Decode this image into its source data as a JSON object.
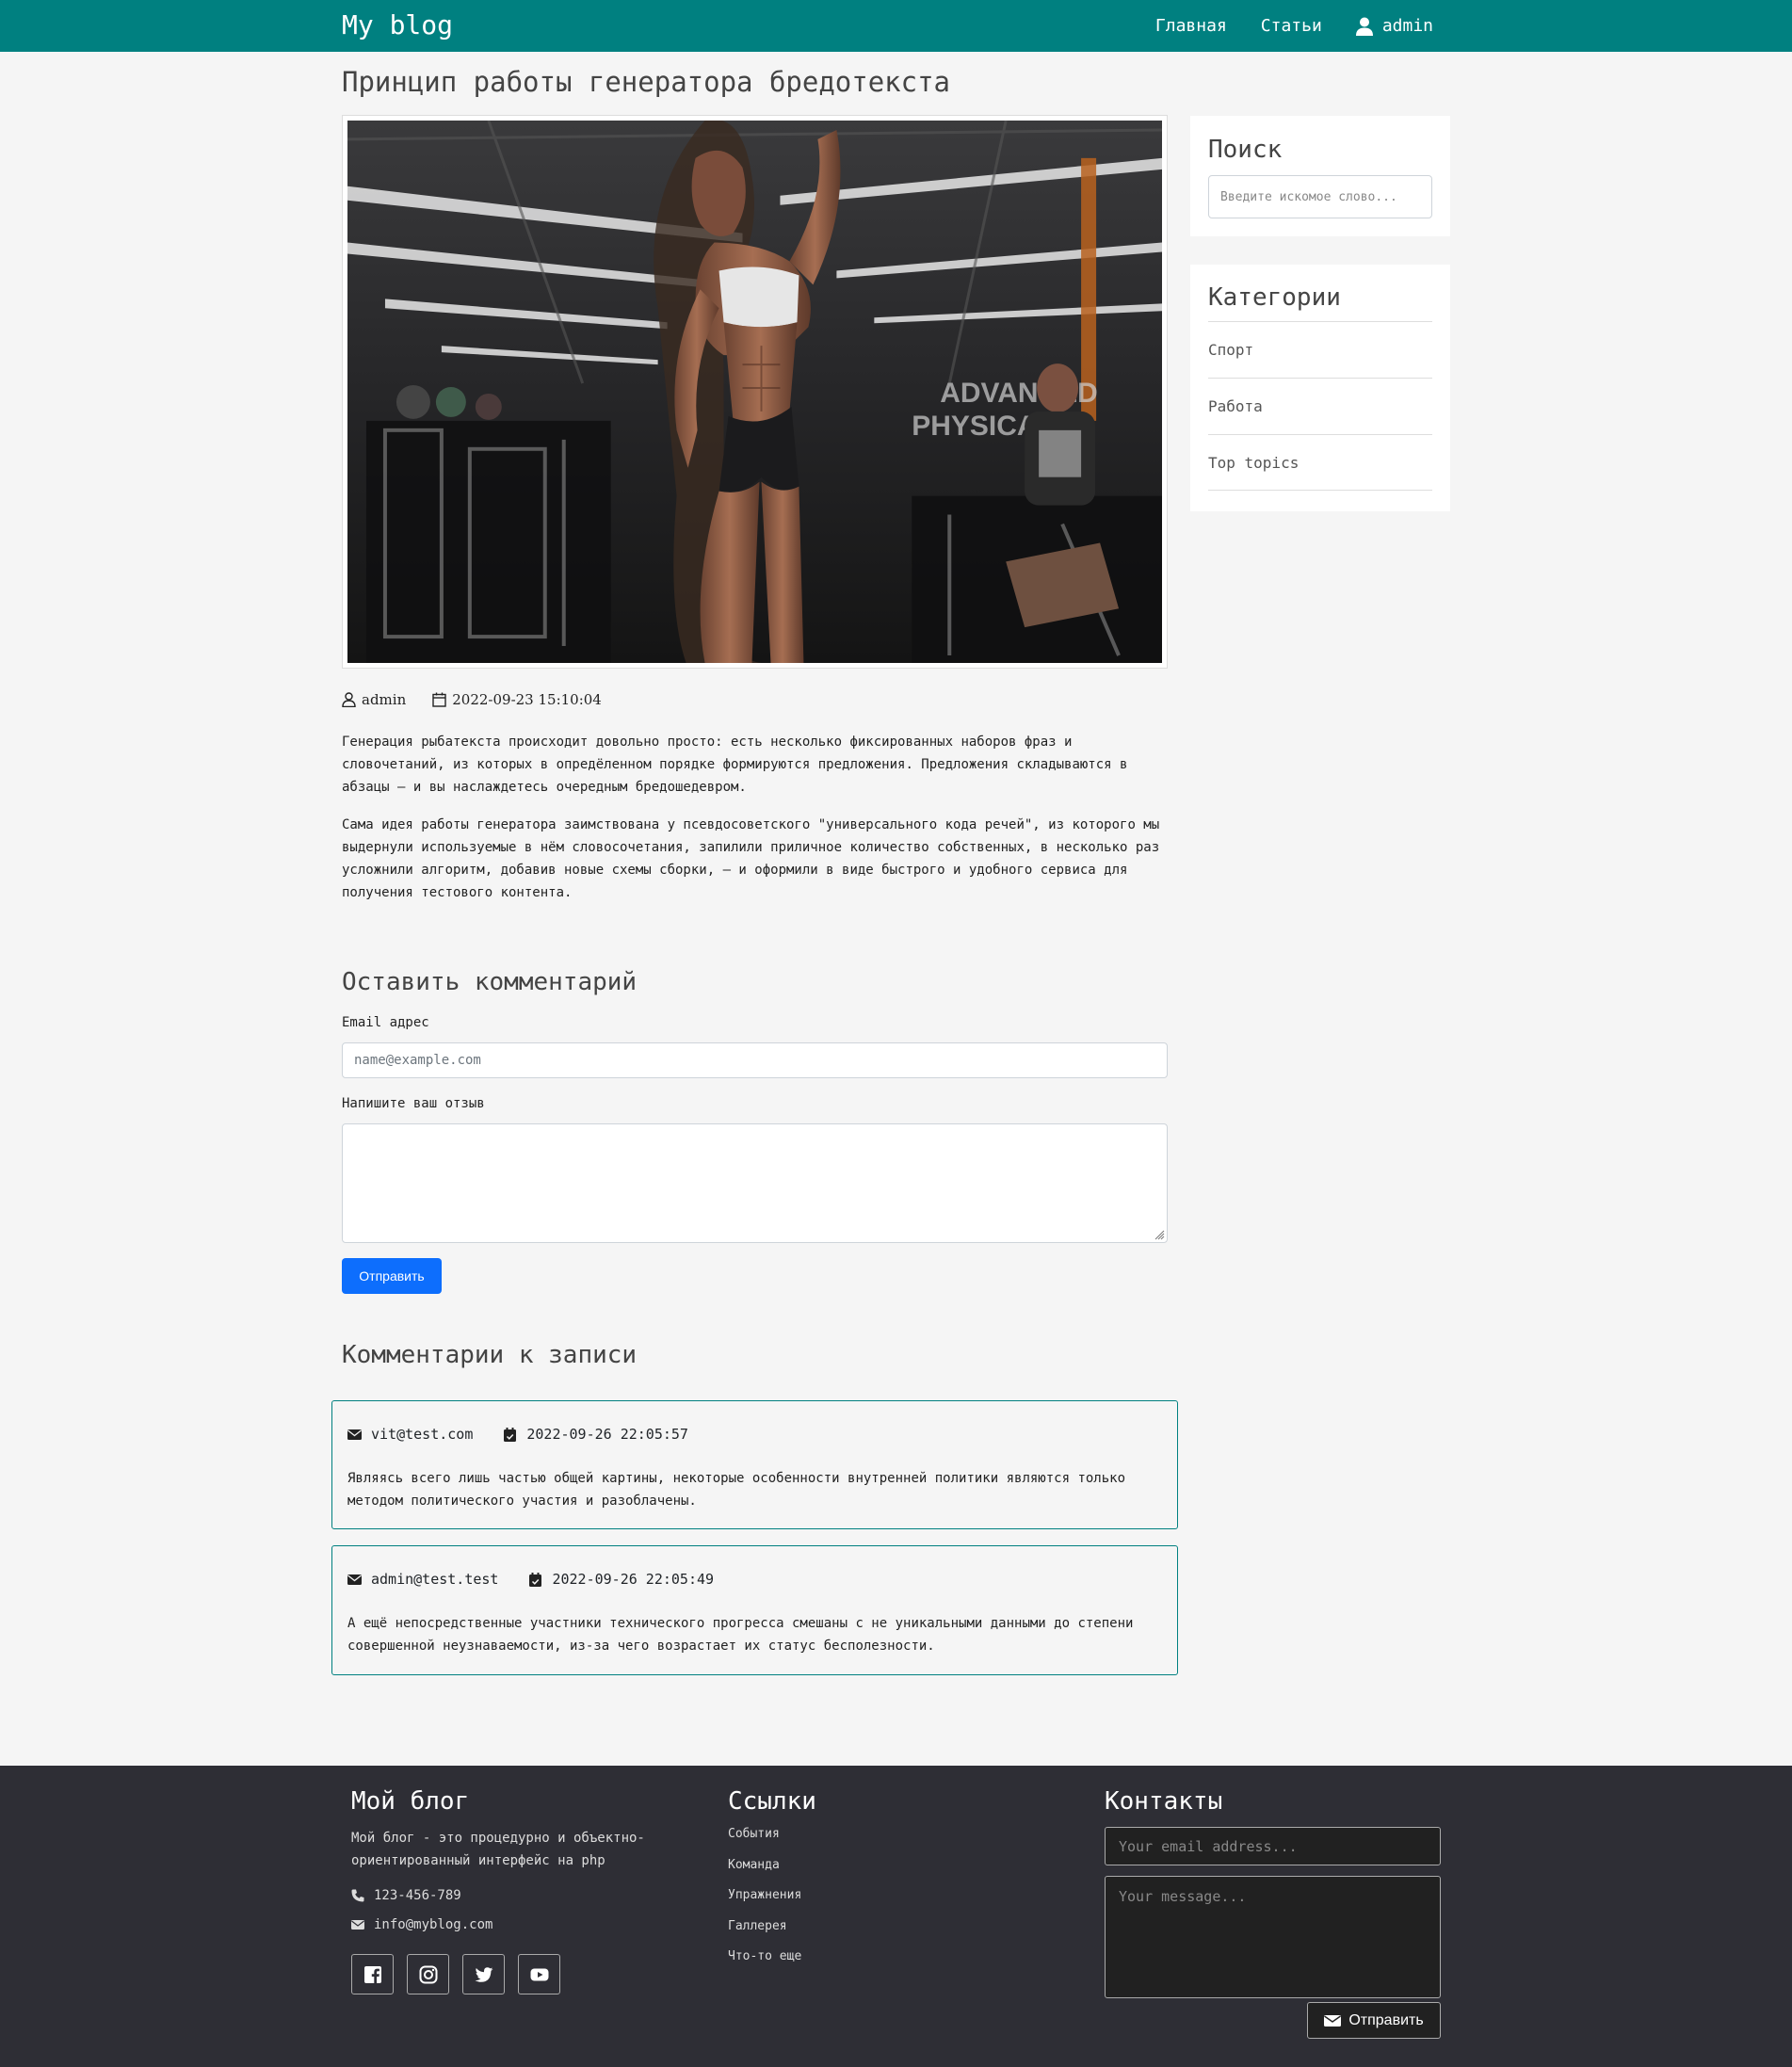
{
  "navbar": {
    "brand": "My blog",
    "links": [
      "Главная",
      "Статьи"
    ],
    "user": "admin",
    "color": "#008080"
  },
  "article": {
    "title": "Принцип работы генератора бредотекста",
    "author": "admin",
    "date": "2022-09-23 15:10:04",
    "paragraphs": [
      "Генерация рыбатекста происходит довольно просто: есть несколько фиксированных наборов фраз и словочетаний, из которых в опредёленном порядке формируются предложения. Предложения складываются в абзацы — и вы наслаждетесь очередным бредошедевром.",
      "Сама идея работы генератора заимствована у псевдосоветского \"универсального кода речей\", из которого мы выдернули используемые в нём словосочетания, запилили приличное количество собственных, в несколько раз усложнили алгоритм, добавив новые схемы сборки, — и оформили в виде быстрого и удобного сервиса для получения тестового контента."
    ]
  },
  "comment_form": {
    "title": "Оставить комментарий",
    "email_label": "Email адрес",
    "email_placeholder": "name@example.com",
    "message_label": "Напишите ваш отзыв",
    "submit": "Отправить",
    "button_color": "#0d6efd"
  },
  "comments": {
    "title": "Комментарии к записи",
    "items": [
      {
        "email": "vit@test.com",
        "date": "2022-09-26 22:05:57",
        "text": "Являясь всего лишь частью общей картины, некоторые особенности внутренней политики являются только методом политического участия и разоблачены."
      },
      {
        "email": "admin@test.test",
        "date": "2022-09-26 22:05:49",
        "text": "А ещё непосредственные участники технического прогресса смешаны с не уникальными данными до степени совершенной неузнаваемости, из-за чего возрастает их статус бесполезности."
      }
    ]
  },
  "sidebar": {
    "search_title": "Поиск",
    "search_placeholder": "Введите искомое слово...",
    "categories_title": "Категории",
    "categories": [
      "Спорт",
      "Работа",
      "Top topics"
    ]
  },
  "footer": {
    "about_title": "Мой блог",
    "about_text": "Мой блог - это процедурно и объектно-ориентированный интерфейс на php",
    "phone": "123-456-789",
    "email": "info@myblog.com",
    "socials": [
      "facebook-icon",
      "instagram-icon",
      "twitter-icon",
      "youtube-icon"
    ],
    "links_title": "Ссылки",
    "links": [
      "События",
      "Команда",
      "Упражнения",
      "Галлерея",
      "Что-то еще"
    ],
    "contacts_title": "Контакты",
    "contact_email_placeholder": "Your email address...",
    "contact_message_placeholder": "Your message...",
    "contact_submit": "Отправить",
    "background": "#2e2e35"
  }
}
